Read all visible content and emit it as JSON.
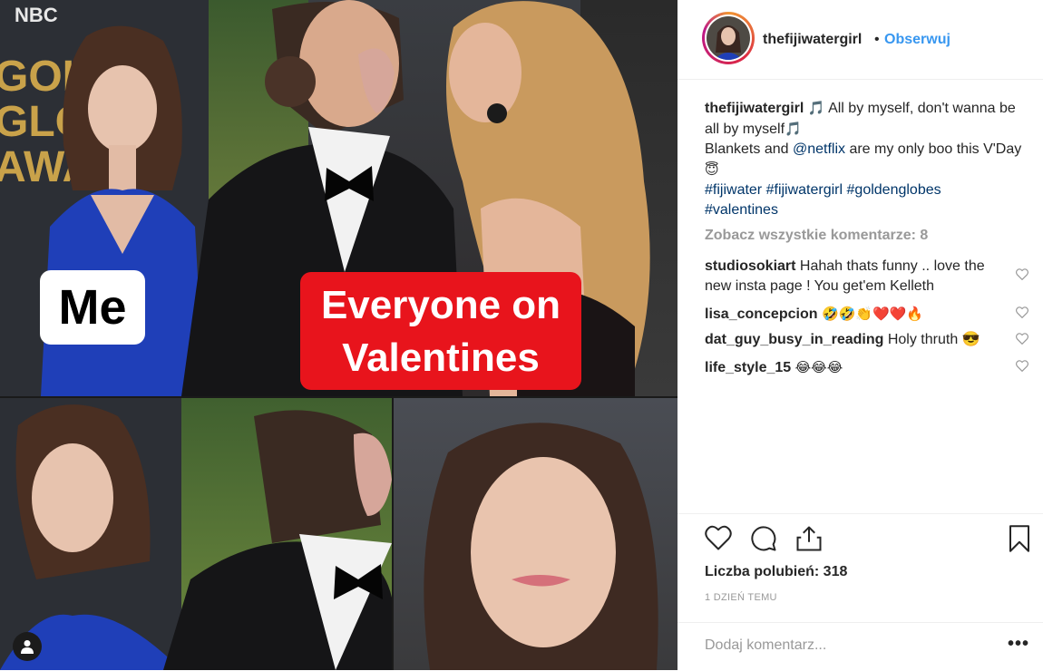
{
  "meme": {
    "label_me": "Me",
    "label_everyone_line1": "Everyone on",
    "label_everyone_line2": "Valentines",
    "watermark": "NBC",
    "backdrop_text_1": "GOLD",
    "backdrop_text_2": "GLO",
    "backdrop_text_3": "AWA"
  },
  "header": {
    "username": "thefijiwatergirl",
    "separator": "•",
    "follow_label": "Obserwuj"
  },
  "caption": {
    "username": "thefijiwatergirl",
    "line1": " All by myself, don't wanna be all by myself",
    "line2": "Blankets and ",
    "mention": "@netflix",
    "line2b": " are my only boo this V'Day ",
    "tags": [
      "#fijiwater",
      "#fijiwatergirl",
      "#goldenglobes",
      "#valentines"
    ],
    "music_emoji": "🎵",
    "angel_emoji": "😇"
  },
  "view_all_comments": "Zobacz wszystkie komentarze: 8",
  "comments": [
    {
      "user": "studiosokiart",
      "text": "Hahah thats funny .. love the new insta page ! You get'em Kelleth"
    },
    {
      "user": "lisa_concepcion",
      "text": "🤣🤣👏❤️❤️🔥"
    },
    {
      "user": "dat_guy_busy_in_reading",
      "text": "Holy thruth 😎"
    },
    {
      "user": "life_style_15",
      "text": "😂😂😂"
    }
  ],
  "likes_label": "Liczba polubień: 318",
  "timestamp": "1 DZIEŃ TEMU",
  "add_comment_placeholder": "Dodaj komentarz...",
  "more_label": "•••",
  "colors": {
    "link": "#3897f0",
    "hashtag": "#003569",
    "muted": "#999999",
    "label_red": "#e8141c"
  }
}
